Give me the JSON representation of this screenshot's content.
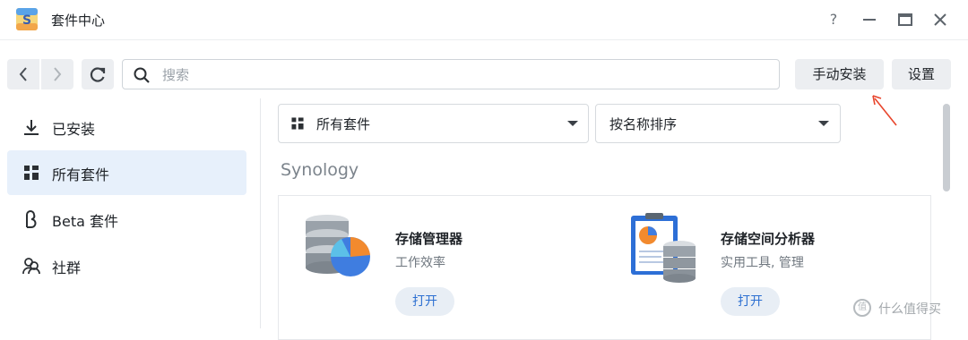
{
  "window": {
    "title": "套件中心",
    "help": "?"
  },
  "toolbar": {
    "search_placeholder": "搜索",
    "manual_install_label": "手动安装",
    "settings_label": "设置"
  },
  "sidebar": {
    "items": [
      {
        "label": "已安装",
        "icon": "download-icon",
        "active": false
      },
      {
        "label": "所有套件",
        "icon": "grid-icon",
        "active": true
      },
      {
        "label": "Beta 套件",
        "icon": "beta-icon",
        "active": false
      },
      {
        "label": "社群",
        "icon": "community-icon",
        "active": false
      }
    ]
  },
  "filters": {
    "category": "所有套件",
    "sort": "按名称排序"
  },
  "section": {
    "title": "Synology"
  },
  "packages": [
    {
      "name": "存储管理器",
      "category": "工作效率",
      "action": "打开",
      "icon": "storage-manager-icon"
    },
    {
      "name": "存储空间分析器",
      "category": "实用工具, 管理",
      "action": "打开",
      "icon": "storage-analyzer-icon"
    }
  ],
  "watermark": {
    "text": "什么值得买",
    "icon_glyph": "值"
  },
  "colors": {
    "accent": "#2c6fd1",
    "active_bg": "#e7f0fb",
    "annotation": "#e8452c"
  }
}
